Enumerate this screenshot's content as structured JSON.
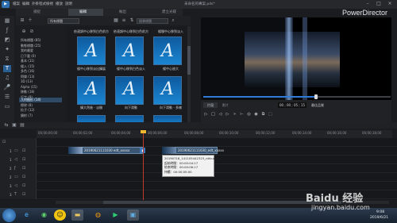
{
  "window": {
    "title": "未命名的專案.pds*",
    "menus": [
      "檔案",
      "編輯",
      "外掛程式",
      "檢視",
      "播放",
      "說明"
    ],
    "brand": "PowerDirector"
  },
  "tabs": [
    {
      "label": "捕捉",
      "active": false
    },
    {
      "label": "編輯",
      "active": true
    },
    {
      "label": "輸出",
      "active": false
    },
    {
      "label": "建立光碟",
      "active": false
    }
  ],
  "library": {
    "category_dropdown": "所有標題",
    "search_placeholder": "搜尋標題",
    "categories": [
      {
        "label": "所有標題 (85)",
        "selected": false
      },
      {
        "label": "動態標題 (25)",
        "selected": false
      },
      {
        "label": "我的最愛",
        "selected": false
      },
      {
        "label": "已下載 (0)",
        "selected": false
      },
      {
        "label": "基本 (11)",
        "selected": false
      },
      {
        "label": "緩入 (15)",
        "selected": false
      },
      {
        "label": "多色 (16)",
        "selected": false
      },
      {
        "label": "閃爍 (13)",
        "selected": false
      },
      {
        "label": "3D (13)",
        "selected": false
      },
      {
        "label": "Alpha (15)",
        "selected": false
      },
      {
        "label": "移動 (18)",
        "selected": false
      },
      {
        "label": "打字 (9)",
        "selected": false
      },
      {
        "label": "几何图形 (14)",
        "selected": true
      },
      {
        "label": "擦除 (8)",
        "selected": false
      },
      {
        "label": "粒子 (12)",
        "selected": false
      },
      {
        "label": "鏡射 (7)",
        "selected": false
      }
    ],
    "thumbnails": [
      {
        "label": "依速調中心移到白色前方",
        "glyph": "A"
      },
      {
        "label": "依速調中心移到白色前方",
        "glyph": "A"
      },
      {
        "label": "緩慢中心移到淡入",
        "glyph": "A"
      },
      {
        "label": "緩中心移到淡出擴展",
        "glyph": "A"
      },
      {
        "label": "緩中心移到白色淡入",
        "glyph": "A"
      },
      {
        "label": "緩中心放大",
        "glyph": "A"
      },
      {
        "label": "擴大然後 - 淡開",
        "glyph": "A"
      },
      {
        "label": "向下滑動",
        "glyph": "A"
      },
      {
        "label": "向下滑動 - 多樣",
        "glyph": "A"
      }
    ],
    "thumb_colors": {
      "frame": "#3d6fa0",
      "fill": "#1b86d2"
    }
  },
  "preview": {
    "mode_clip": "片段",
    "mode_movie": "影片",
    "timecode": "00 ; 00 ; 05 ; 15",
    "quality": "最佳品質",
    "progress": 0.6
  },
  "timeline": {
    "ruler": [
      "00;00;00;00",
      "00;00;02;00",
      "00;00;04;00",
      "00;00;06;00",
      "00;00;08;00",
      "00;00;10;00",
      "00;00;12;00",
      "00;00;14;00",
      "00;00;16;00",
      "00;00;18;00"
    ],
    "tracks": [
      "1",
      "1",
      "2",
      "2",
      "3",
      "3"
    ],
    "clip_a_label": "20190621111030 edt_xxxxx",
    "clip_b_label": "20190621111030_edt_xxxxx",
    "tooltip": [
      "20190718_141105442323_ntfcumb",
      "起始時間：00:00:04:17",
      "結束時間：00:00:06:17",
      "持續：00:00:05:00"
    ]
  },
  "taskbar": {
    "time": "9:08",
    "date": "2019/6/21"
  },
  "watermark": {
    "text": "Baidu 经验",
    "url": "jingyan.baidu.com"
  }
}
